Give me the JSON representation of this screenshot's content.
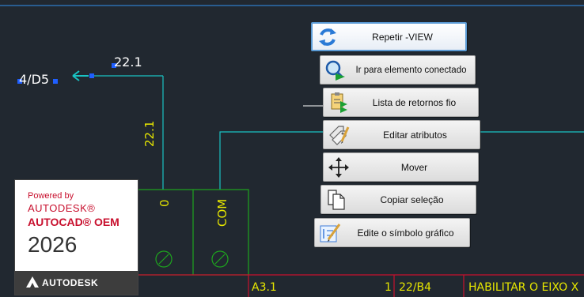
{
  "drawing": {
    "label_4d5": "4/D5",
    "wire_221_top": "22.1",
    "wire_221_vertical": "22.1",
    "terminal_0": "0",
    "terminal_com": "COM",
    "bottom_a31": "A3.1",
    "bottom_1": "1",
    "bottom_22b4": "22/B4",
    "bottom_desc": "HABILITAR O EIXO X"
  },
  "context_menu": {
    "items": [
      {
        "label": "Repetir -VIEW",
        "icon": "refresh-icon"
      },
      {
        "label": "Ir para elemento conectado",
        "icon": "magnifier-arrow-icon"
      },
      {
        "label": "Lista de retornos fio",
        "icon": "wire-list-icon"
      },
      {
        "label": "Editar atributos",
        "icon": "edit-attributes-icon"
      },
      {
        "label": "Mover",
        "icon": "move-arrows-icon"
      },
      {
        "label": "Copiar seleção",
        "icon": "copy-icon"
      },
      {
        "label": "Edite o símbolo gráfico",
        "icon": "edit-symbol-icon"
      }
    ]
  },
  "badge": {
    "powered_by": "Powered by",
    "autodesk": "AUTODESK®",
    "product": "AUTOCAD® OEM",
    "year": "2026",
    "footer": "AUTODESK"
  },
  "colors": {
    "background": "#212830",
    "wire": "#19c3c3",
    "green_box": "#1ea51e",
    "red_lines": "#c8102e",
    "text_yellow": "#e6e600",
    "grip_blue": "#1f5fff"
  }
}
